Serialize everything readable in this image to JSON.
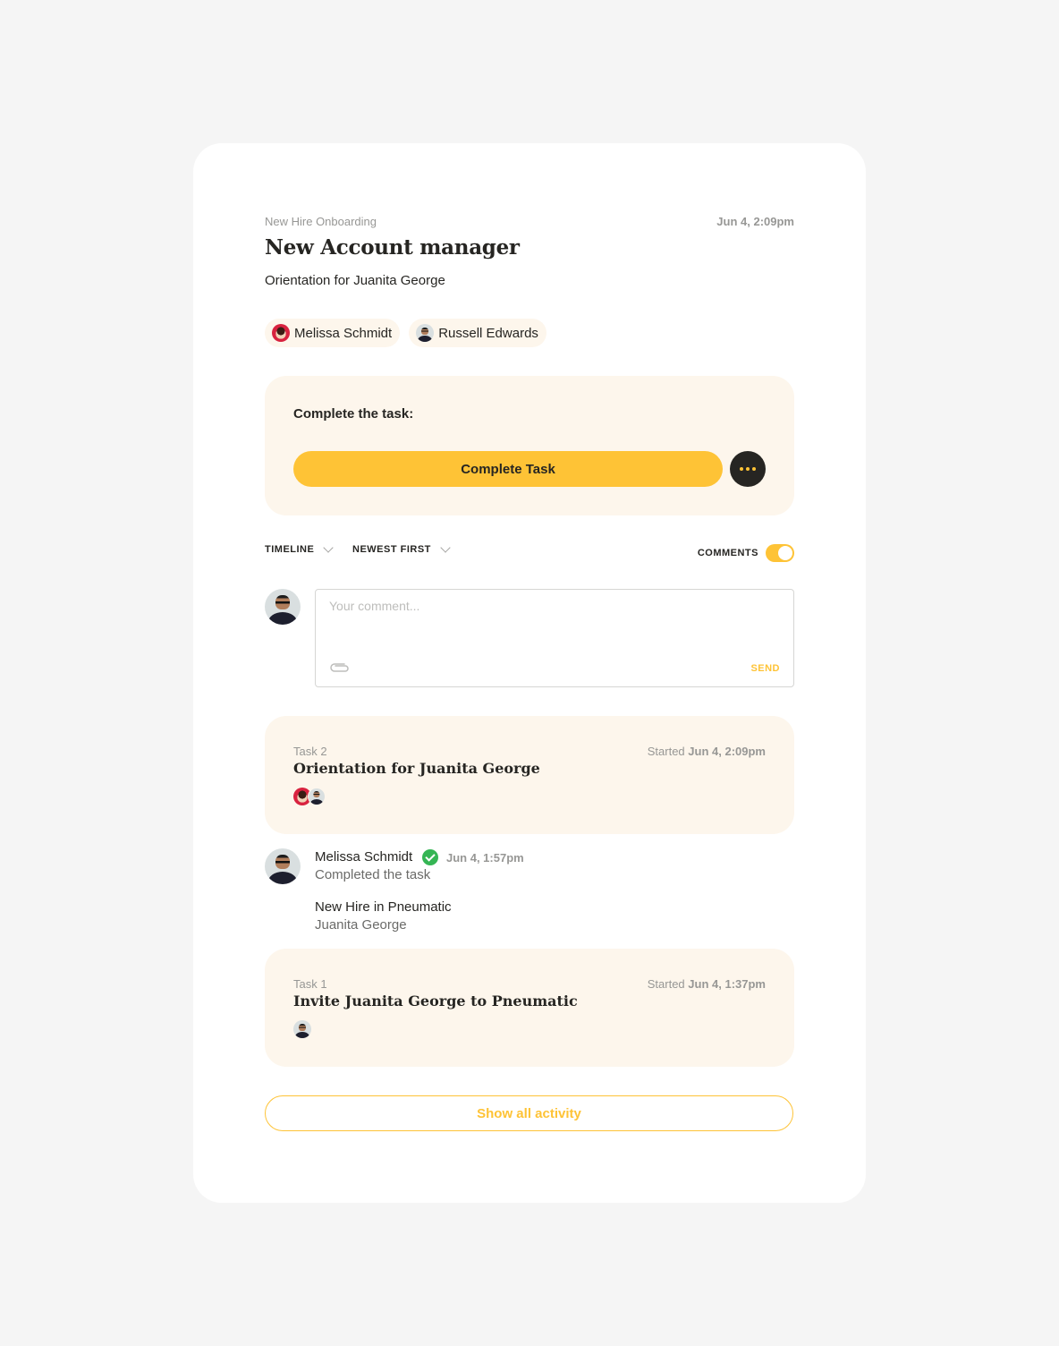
{
  "header": {
    "breadcrumb": "New Hire Onboarding",
    "date": "Jun 4, 2:09pm",
    "title": "New Account manager",
    "subtitle": "Orientation for Juanita George"
  },
  "performers": [
    {
      "name": "Melissa Schmidt",
      "avatar": "female-avatar"
    },
    {
      "name": "Russell Edwards",
      "avatar": "male-avatar"
    }
  ],
  "action_panel": {
    "label": "Complete the task:",
    "complete_button": "Complete Task",
    "more_icon": "more-dots-icon"
  },
  "filters": {
    "timeline": "TIMELINE",
    "sort": "NEWEST FIRST",
    "comments_label": "COMMENTS",
    "comments_enabled": true
  },
  "comment": {
    "placeholder": "Your comment...",
    "value": "",
    "attach_icon": "paperclip-icon",
    "send_label": "SEND"
  },
  "timeline": {
    "tasks": [
      {
        "number": "Task 2",
        "started_prefix": "Started",
        "started_date": "Jun 4, 2:09pm",
        "title": "Orientation for Juanita George",
        "performers": [
          "female-avatar",
          "male-avatar"
        ]
      },
      {
        "number": "Task 1",
        "started_prefix": "Started",
        "started_date": "Jun 4, 1:37pm",
        "title": "Invite Juanita George to Pneumatic",
        "performers": [
          "male-avatar"
        ]
      }
    ],
    "activity": {
      "user": "Melissa Schmidt",
      "status_icon": "check-circle-icon",
      "time": "Jun 4, 1:57pm",
      "description": "Completed the task",
      "field_label": "New Hire in Pneumatic",
      "field_value": "Juanita George"
    }
  },
  "show_all_label": "Show all activity",
  "colors": {
    "accent": "#fec336",
    "panel_bg": "#fdf6ec",
    "dark": "#262522",
    "success": "#35b554",
    "muted": "#979795"
  }
}
